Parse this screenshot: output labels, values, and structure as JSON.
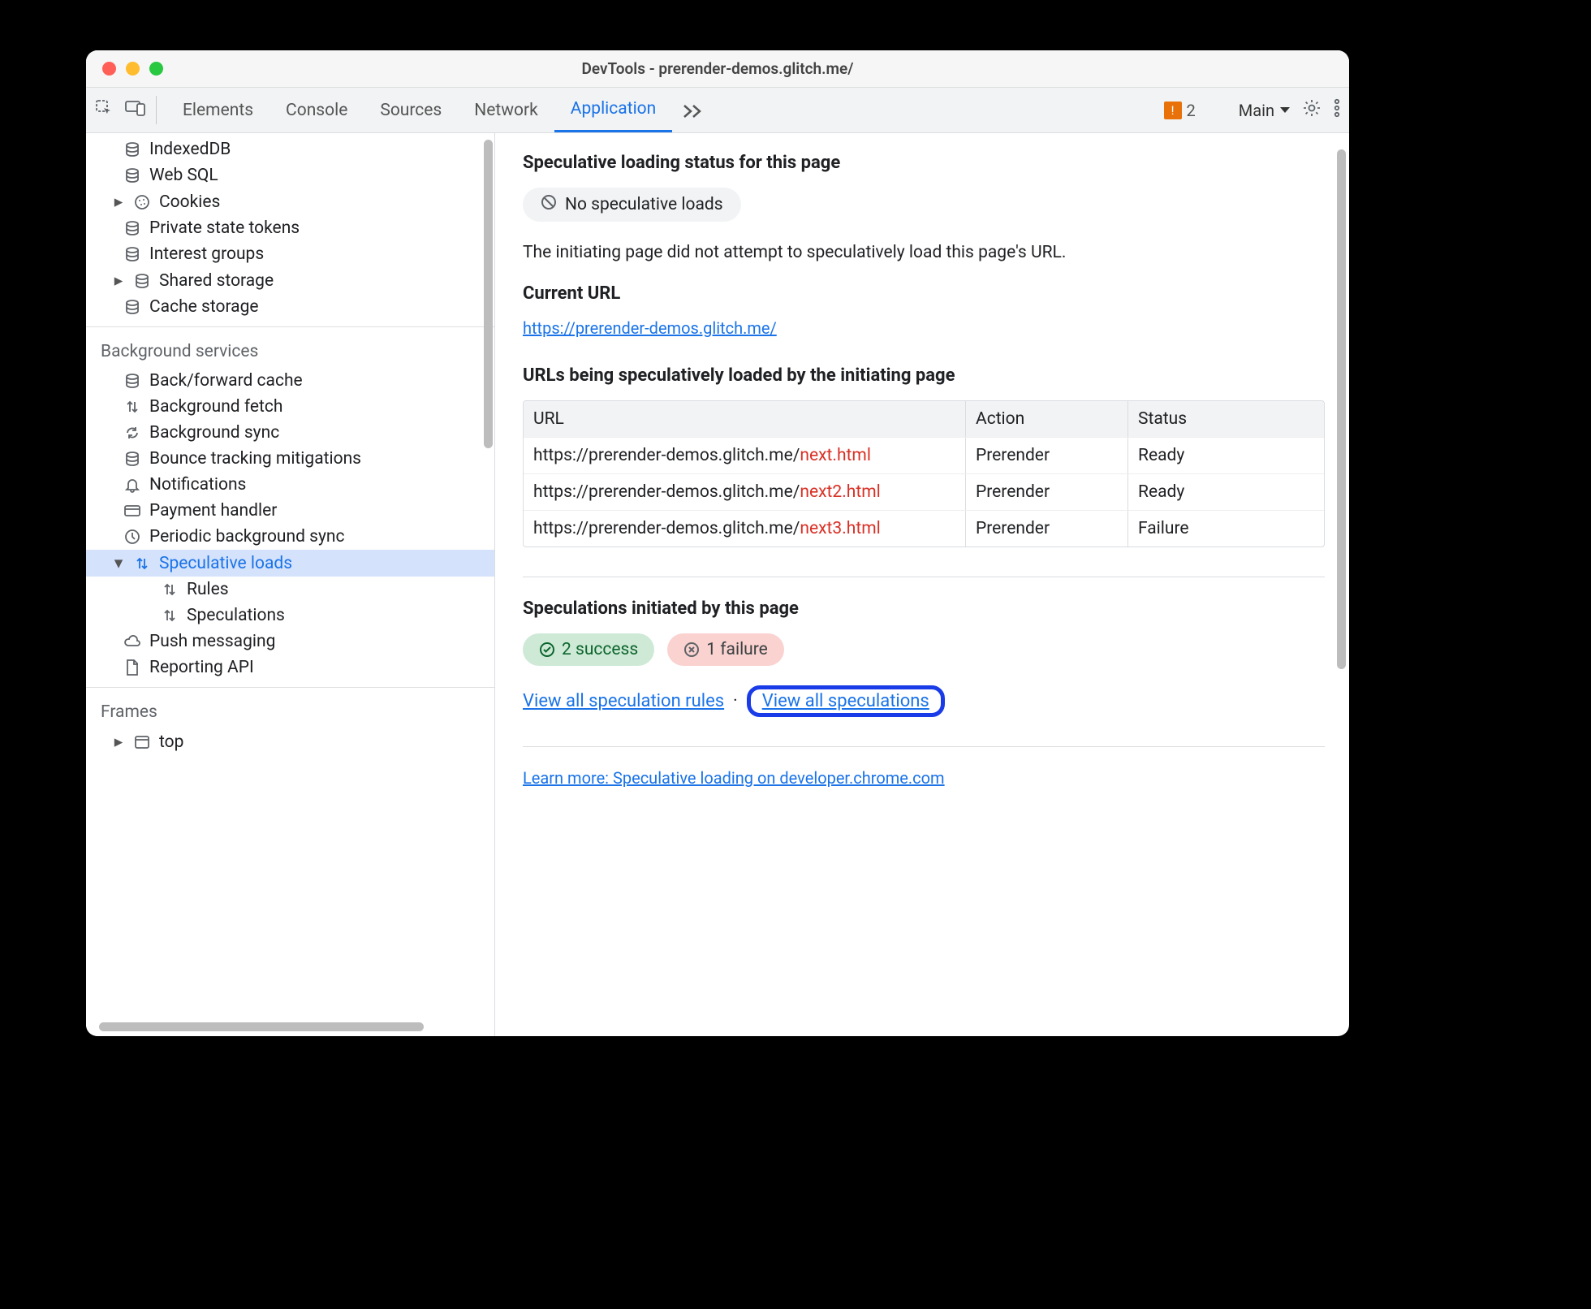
{
  "window": {
    "title": "DevTools - prerender-demos.glitch.me/"
  },
  "tabbar": {
    "tabs": [
      "Elements",
      "Console",
      "Sources",
      "Network",
      "Application"
    ],
    "active_index": 4,
    "warnings_count": "2",
    "frame_select": "Main"
  },
  "sidebar": {
    "storage": {
      "items": [
        {
          "label": "IndexedDB",
          "icon": "database-icon"
        },
        {
          "label": "Web SQL",
          "icon": "database-icon"
        },
        {
          "label": "Cookies",
          "icon": "cookie-icon",
          "expandable": true
        },
        {
          "label": "Private state tokens",
          "icon": "database-icon"
        },
        {
          "label": "Interest groups",
          "icon": "database-icon"
        },
        {
          "label": "Shared storage",
          "icon": "database-icon",
          "expandable": true
        },
        {
          "label": "Cache storage",
          "icon": "database-icon"
        }
      ]
    },
    "background_header": "Background services",
    "background": {
      "items": [
        {
          "label": "Back/forward cache",
          "icon": "database-icon"
        },
        {
          "label": "Background fetch",
          "icon": "arrows-updown-icon"
        },
        {
          "label": "Background sync",
          "icon": "sync-icon"
        },
        {
          "label": "Bounce tracking mitigations",
          "icon": "database-icon"
        },
        {
          "label": "Notifications",
          "icon": "bell-icon"
        },
        {
          "label": "Payment handler",
          "icon": "card-icon"
        },
        {
          "label": "Periodic background sync",
          "icon": "clock-icon"
        },
        {
          "label": "Speculative loads",
          "icon": "arrows-updown-icon",
          "expanded": true,
          "selected": true,
          "children": [
            {
              "label": "Rules",
              "icon": "arrows-updown-icon"
            },
            {
              "label": "Speculations",
              "icon": "arrows-updown-icon"
            }
          ]
        },
        {
          "label": "Push messaging",
          "icon": "cloud-icon"
        },
        {
          "label": "Reporting API",
          "icon": "file-icon"
        }
      ]
    },
    "frames_header": "Frames",
    "frames": {
      "items": [
        {
          "label": "top",
          "icon": "window-icon",
          "expandable": true
        }
      ]
    }
  },
  "panel": {
    "status_heading": "Speculative loading status for this page",
    "status_pill": "No speculative loads",
    "status_desc": "The initiating page did not attempt to speculatively load this page's URL.",
    "current_url_heading": "Current URL",
    "current_url": "https://prerender-demos.glitch.me/",
    "urls_heading": "URLs being speculatively loaded by the initiating page",
    "table": {
      "headers": {
        "url": "URL",
        "action": "Action",
        "status": "Status"
      },
      "rows": [
        {
          "base": "https://prerender-demos.glitch.me/",
          "tail": "next.html",
          "action": "Prerender",
          "status": "Ready"
        },
        {
          "base": "https://prerender-demos.glitch.me/",
          "tail": "next2.html",
          "action": "Prerender",
          "status": "Ready"
        },
        {
          "base": "https://prerender-demos.glitch.me/",
          "tail": "next3.html",
          "action": "Prerender",
          "status": "Failure"
        }
      ]
    },
    "spec_heading": "Speculations initiated by this page",
    "success_badge": "2 success",
    "failure_badge": "1 failure",
    "link_rules": "View all speculation rules",
    "link_specs": "View all speculations",
    "learn_more": "Learn more: Speculative loading on developer.chrome.com"
  }
}
